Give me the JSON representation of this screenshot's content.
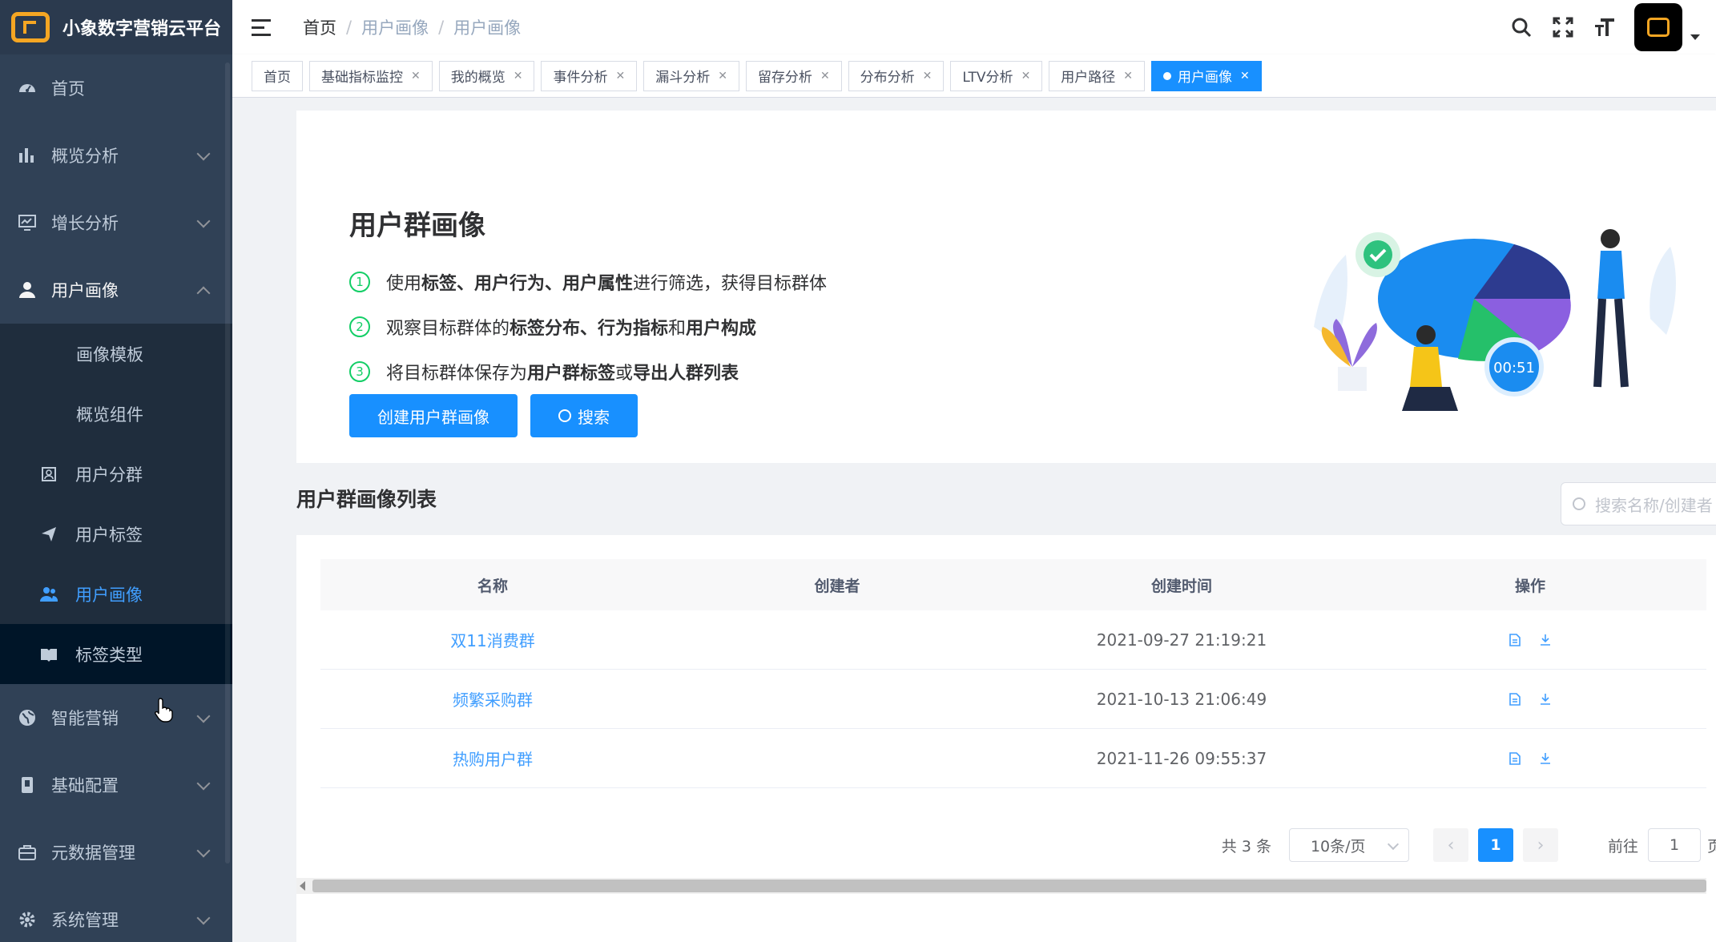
{
  "app": {
    "title": "小象数字营销云平台"
  },
  "colors": {
    "sidebar_bg": "#304156",
    "accent": "#1890ff",
    "active_text": "#409eff",
    "logo": "#f5a623",
    "success": "#13ce66"
  },
  "sidebar": {
    "items": [
      {
        "label": "首页",
        "icon": "dashboard-icon"
      },
      {
        "label": "概览分析",
        "icon": "bar-chart-icon"
      },
      {
        "label": "增长分析",
        "icon": "monitor-icon"
      },
      {
        "label": "用户画像",
        "icon": "user-icon",
        "expanded": true
      },
      {
        "label": "智能营销",
        "icon": "globe-icon"
      },
      {
        "label": "基础配置",
        "icon": "config-icon"
      },
      {
        "label": "元数据管理",
        "icon": "briefcase-icon"
      },
      {
        "label": "系统管理",
        "icon": "gear-icon"
      }
    ],
    "sub_items": [
      {
        "label": "画像模板"
      },
      {
        "label": "概览组件"
      },
      {
        "label": "用户分群",
        "icon": "group-icon"
      },
      {
        "label": "用户标签",
        "icon": "send-icon"
      },
      {
        "label": "用户画像",
        "icon": "user-portrait-icon",
        "active": true
      },
      {
        "label": "标签类型",
        "icon": "book-icon"
      }
    ]
  },
  "navbar": {
    "breadcrumb": [
      "首页",
      "用户画像",
      "用户画像"
    ],
    "breadcrumb_sep": "/",
    "icons": [
      "search-icon",
      "fullscreen-icon",
      "font-size-icon"
    ]
  },
  "tags": [
    {
      "label": "首页",
      "closable": false
    },
    {
      "label": "基础指标监控",
      "closable": true
    },
    {
      "label": "我的概览",
      "closable": true
    },
    {
      "label": "事件分析",
      "closable": true
    },
    {
      "label": "漏斗分析",
      "closable": true
    },
    {
      "label": "留存分析",
      "closable": true
    },
    {
      "label": "分布分析",
      "closable": true
    },
    {
      "label": "LTV分析",
      "closable": true
    },
    {
      "label": "用户路径",
      "closable": true
    },
    {
      "label": "用户画像",
      "closable": true,
      "active": true
    }
  ],
  "hero": {
    "title": "用户群画像",
    "steps": [
      {
        "num": "1",
        "parts": [
          [
            "使用 ",
            false
          ],
          [
            "标签、用户行为、用户属性",
            true
          ],
          [
            " 进行筛选，获得目标群体",
            false
          ]
        ]
      },
      {
        "num": "2",
        "parts": [
          [
            "观察目标群体的 ",
            false
          ],
          [
            "标签分布、行为指标",
            true
          ],
          [
            " 和 ",
            false
          ],
          [
            "用户构成",
            true
          ]
        ]
      },
      {
        "num": "3",
        "parts": [
          [
            "将目标群体保存为 ",
            false
          ],
          [
            "用户群标签",
            true
          ],
          [
            " 或 ",
            false
          ],
          [
            "导出人群列表",
            true
          ]
        ]
      }
    ],
    "create_button": "创建用户群画像",
    "search_button": "搜索",
    "illustration_timer": "00:51"
  },
  "list": {
    "title": "用户群画像列表",
    "search_placeholder": "搜索名称/创建者",
    "columns": [
      "名称",
      "创建者",
      "创建时间",
      "操作"
    ],
    "rows": [
      {
        "name": "双11消费群",
        "creator": "",
        "created": "2021-09-27 21:19:21"
      },
      {
        "name": "频繁采购群",
        "creator": "",
        "created": "2021-10-13 21:06:49"
      },
      {
        "name": "热购用户群",
        "creator": "",
        "created": "2021-11-26 09:55:37"
      }
    ]
  },
  "pagination": {
    "total": "共 3 条",
    "page_size": "10条/页",
    "prev": "‹",
    "next": "›",
    "current": "1",
    "goto_label": "前往",
    "goto_value": "1",
    "page_suffix": "页"
  }
}
